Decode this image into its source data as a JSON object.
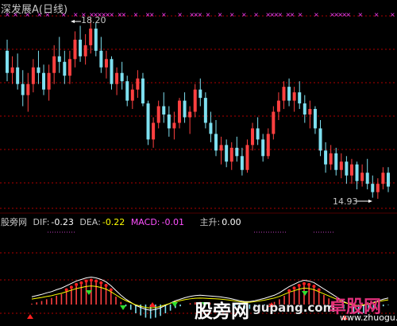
{
  "stock": {
    "title": "深发展A(日线)",
    "high_label": "18.20",
    "low_label": "14.93",
    "candles": [
      [
        17.6,
        17.8,
        17.05,
        17.2
      ],
      [
        17.2,
        17.5,
        17.0,
        17.3
      ],
      [
        17.3,
        17.55,
        16.9,
        17.0
      ],
      [
        17.0,
        17.25,
        16.6,
        16.8
      ],
      [
        16.8,
        17.2,
        16.5,
        17.0
      ],
      [
        17.0,
        17.45,
        16.85,
        17.3
      ],
      [
        17.3,
        17.6,
        17.0,
        17.2
      ],
      [
        17.2,
        17.35,
        16.8,
        16.9
      ],
      [
        16.9,
        17.35,
        16.7,
        17.2
      ],
      [
        17.2,
        17.7,
        17.0,
        17.5
      ],
      [
        17.5,
        17.85,
        17.2,
        17.4
      ],
      [
        17.4,
        17.6,
        17.0,
        17.15
      ],
      [
        17.15,
        17.6,
        17.0,
        17.45
      ],
      [
        17.45,
        17.95,
        17.3,
        17.8
      ],
      [
        17.8,
        18.05,
        17.4,
        17.5
      ],
      [
        17.5,
        17.9,
        17.35,
        17.7
      ],
      [
        17.7,
        18.2,
        17.55,
        18.0
      ],
      [
        18.0,
        18.1,
        17.5,
        17.6
      ],
      [
        17.6,
        17.85,
        17.2,
        17.3
      ],
      [
        17.3,
        17.6,
        17.1,
        17.45
      ],
      [
        17.45,
        17.5,
        16.9,
        17.0
      ],
      [
        17.0,
        17.3,
        16.8,
        17.2
      ],
      [
        17.2,
        17.4,
        16.9,
        17.05
      ],
      [
        17.05,
        17.15,
        16.6,
        16.7
      ],
      [
        16.7,
        17.0,
        16.55,
        16.9
      ],
      [
        16.9,
        17.25,
        16.75,
        17.1
      ],
      [
        17.1,
        17.2,
        16.6,
        16.65
      ],
      [
        16.65,
        16.7,
        15.9,
        16.0
      ],
      [
        16.0,
        16.4,
        15.85,
        16.3
      ],
      [
        16.3,
        16.7,
        16.2,
        16.6
      ],
      [
        16.6,
        16.85,
        16.3,
        16.45
      ],
      [
        16.45,
        16.6,
        16.05,
        16.2
      ],
      [
        16.2,
        16.5,
        16.0,
        16.3
      ],
      [
        16.3,
        16.75,
        16.2,
        16.7
      ],
      [
        16.7,
        16.85,
        16.3,
        16.4
      ],
      [
        16.4,
        16.6,
        16.1,
        16.5
      ],
      [
        16.5,
        17.0,
        16.4,
        16.9
      ],
      [
        16.9,
        17.1,
        16.6,
        16.75
      ],
      [
        16.75,
        16.85,
        16.2,
        16.3
      ],
      [
        16.3,
        16.5,
        15.95,
        16.1
      ],
      [
        16.1,
        16.35,
        15.7,
        15.8
      ],
      [
        15.8,
        16.05,
        15.55,
        15.9
      ],
      [
        15.9,
        16.0,
        15.5,
        15.6
      ],
      [
        15.6,
        15.95,
        15.45,
        15.85
      ],
      [
        15.85,
        16.05,
        15.6,
        15.7
      ],
      [
        15.7,
        15.85,
        15.35,
        15.45
      ],
      [
        15.45,
        16.0,
        15.4,
        15.9
      ],
      [
        15.9,
        16.3,
        15.8,
        16.2
      ],
      [
        16.2,
        16.4,
        15.9,
        16.0
      ],
      [
        16.0,
        16.1,
        15.6,
        15.7
      ],
      [
        15.7,
        16.2,
        15.65,
        16.1
      ],
      [
        16.1,
        16.6,
        16.0,
        16.5
      ],
      [
        16.5,
        16.85,
        16.35,
        16.7
      ],
      [
        16.7,
        17.05,
        16.55,
        16.95
      ],
      [
        16.95,
        17.1,
        16.6,
        16.7
      ],
      [
        16.7,
        16.95,
        16.5,
        16.85
      ],
      [
        16.85,
        17.05,
        16.55,
        16.65
      ],
      [
        16.65,
        16.8,
        16.3,
        16.45
      ],
      [
        16.45,
        16.7,
        16.2,
        16.55
      ],
      [
        16.55,
        16.6,
        16.1,
        16.2
      ],
      [
        16.2,
        16.35,
        15.7,
        15.8
      ],
      [
        15.8,
        15.95,
        15.4,
        15.55
      ],
      [
        15.55,
        15.9,
        15.45,
        15.75
      ],
      [
        15.75,
        15.85,
        15.35,
        15.45
      ],
      [
        15.45,
        15.75,
        15.3,
        15.6
      ],
      [
        15.6,
        15.7,
        15.2,
        15.35
      ],
      [
        15.35,
        15.65,
        15.2,
        15.55
      ],
      [
        15.55,
        15.6,
        15.1,
        15.25
      ],
      [
        15.25,
        15.55,
        15.15,
        15.4
      ],
      [
        15.4,
        15.65,
        15.1,
        15.2
      ],
      [
        15.2,
        15.35,
        14.95,
        15.05
      ],
      [
        15.05,
        15.3,
        14.93,
        15.2
      ],
      [
        15.2,
        15.5,
        15.1,
        15.4
      ],
      [
        15.4,
        15.5,
        15.05,
        15.15
      ]
    ],
    "markers_magenta": "x x  x  x x   x  x x xxxxxx xx  x  xx  x   x  xxx x  x  x  x  x  xxxx xx x   x   xxxxx  x   x   x",
    "colors": {
      "up": "#ff4040",
      "down": "#7ee0f0",
      "grid": "#b00000",
      "marker": "#ff40ff",
      "text": "#c8c8c8"
    }
  },
  "indicator": {
    "name": "股旁网",
    "dif_label": "DIF:",
    "dif_value": "-0.23",
    "dea_label": "DEA:",
    "dea_value": "-0.22",
    "macd_label": "MACD:",
    "macd_value": "-0.01",
    "zs_label": "主升:",
    "zs_value": "0.00",
    "colors": {
      "dif": "#ffffff",
      "dea": "#ffff00",
      "macd": "#ff50ff",
      "label": "#c8c8c8",
      "zs": "#ffffff"
    },
    "macd_hist": [
      0.02,
      0.05,
      0.08,
      0.12,
      0.15,
      0.2,
      0.24,
      0.3,
      0.36,
      0.42,
      0.46,
      0.5,
      0.52,
      0.5,
      0.46,
      0.4,
      0.3,
      0.18,
      0.06,
      -0.04,
      -0.12,
      -0.2,
      -0.25,
      -0.3,
      -0.32,
      -0.3,
      -0.26,
      -0.2,
      -0.14,
      -0.08,
      -0.04,
      0.0,
      0.03,
      0.05,
      0.06,
      0.05,
      0.04,
      0.03,
      0.02,
      0.0,
      -0.02,
      -0.05,
      -0.08,
      -0.1,
      -0.1,
      -0.08,
      -0.05,
      -0.02,
      0.02,
      0.06,
      0.12,
      0.2,
      0.28,
      0.34,
      0.4,
      0.44,
      0.42,
      0.38,
      0.3,
      0.22,
      0.14,
      0.06,
      -0.02,
      -0.1,
      -0.16,
      -0.2,
      -0.22,
      -0.2,
      -0.16,
      -0.12,
      -0.08,
      -0.04,
      -0.01
    ]
  },
  "watermark": {
    "site_cn": "股旁网",
    "site_en": "gupang.com",
    "logo_text": "卓股网",
    "logo_url": "www.zhuogu.com"
  }
}
